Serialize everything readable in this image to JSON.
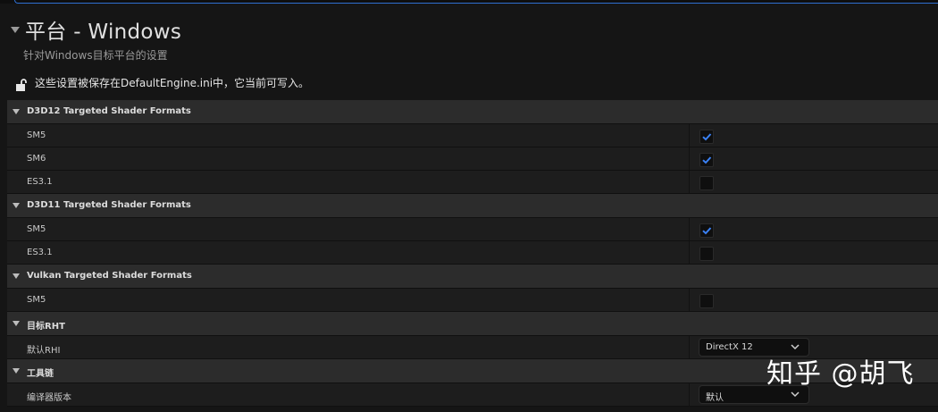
{
  "header": {
    "title": "平台 - Windows",
    "subtitle": "针对Windows目标平台的设置",
    "notice": "这些设置被保存在DefaultEngine.ini中，它当前可写入。"
  },
  "sections": {
    "d3d12": {
      "label": "D3D12 Targeted Shader Formats",
      "items": [
        {
          "label": "SM5",
          "checked": true
        },
        {
          "label": "SM6",
          "checked": true
        },
        {
          "label": "ES3.1",
          "checked": false
        }
      ]
    },
    "d3d11": {
      "label": "D3D11 Targeted Shader Formats",
      "items": [
        {
          "label": "SM5",
          "checked": true
        },
        {
          "label": "ES3.1",
          "checked": false
        }
      ]
    },
    "vulkan": {
      "label": "Vulkan Targeted Shader Formats",
      "items": [
        {
          "label": "SM5",
          "checked": false
        }
      ]
    },
    "rhi": {
      "label": "目标RHT",
      "default_rhi_label": "默认RHI",
      "default_rhi_value": "DirectX 12"
    },
    "toolchain": {
      "label": "工具链",
      "compiler_label": "编译器版本",
      "compiler_value": "默认"
    }
  },
  "watermark": "知乎 @胡飞",
  "colors": {
    "accent": "#2f6fd1",
    "check": "#3b82f6",
    "category_bg": "#2c2c2c",
    "row_bg": "#1d1d1d"
  }
}
